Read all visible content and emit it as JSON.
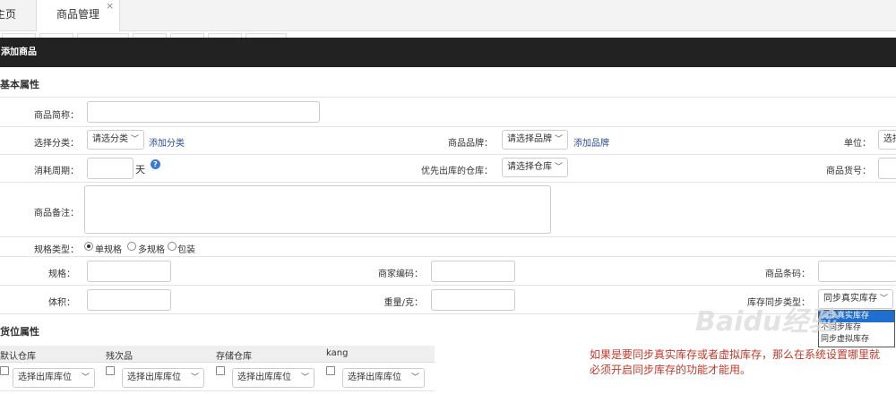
{
  "tabs": {
    "home": "主页",
    "product_mgmt": "商品管理",
    "close": "×"
  },
  "header": {
    "title": "添加商品"
  },
  "basic": {
    "section_title": "基本属性",
    "short_name_label": "商品简称：",
    "category_label": "选择分类：",
    "category_select": "请选分类",
    "add_category": "添加分类",
    "brand_label": "商品品牌：",
    "brand_select": "请选择品牌",
    "add_brand": "添加品牌",
    "unit_label": "单位：",
    "unit_select": "选择",
    "period_label": "消耗周期：",
    "period_unit": "天",
    "help_icon": "?",
    "priority_wh_label": "优先出库的仓库：",
    "priority_wh_select": "请选择仓库",
    "sku_label": "商品货号：",
    "remark_label": "商品备注：",
    "spec_type_label": "规格类型：",
    "spec_options": [
      "单规格",
      "多规格",
      "包装"
    ],
    "spec_label": "规格：",
    "merchant_code_label": "商家编码：",
    "barcode_label": "商品条码：",
    "volume_label": "体积：",
    "weight_label": "重量/克：",
    "stock_sync_label": "库存同步类型：",
    "stock_sync_select": "同步真实库存",
    "stock_sync_options": [
      "同步真实库存",
      "不同步库存",
      "同步虚拟库存"
    ]
  },
  "location": {
    "section_title": "货位属性",
    "warehouses": [
      "默认仓库",
      "残次品",
      "存储仓库",
      "kang"
    ],
    "select_placeholder": "选择出库库位"
  },
  "annotation": "如果是要同步真实库存或者虚拟库存，那么在系统设置哪里就必须开启同步库存的功能才能用。",
  "watermark": "Baidu经验"
}
